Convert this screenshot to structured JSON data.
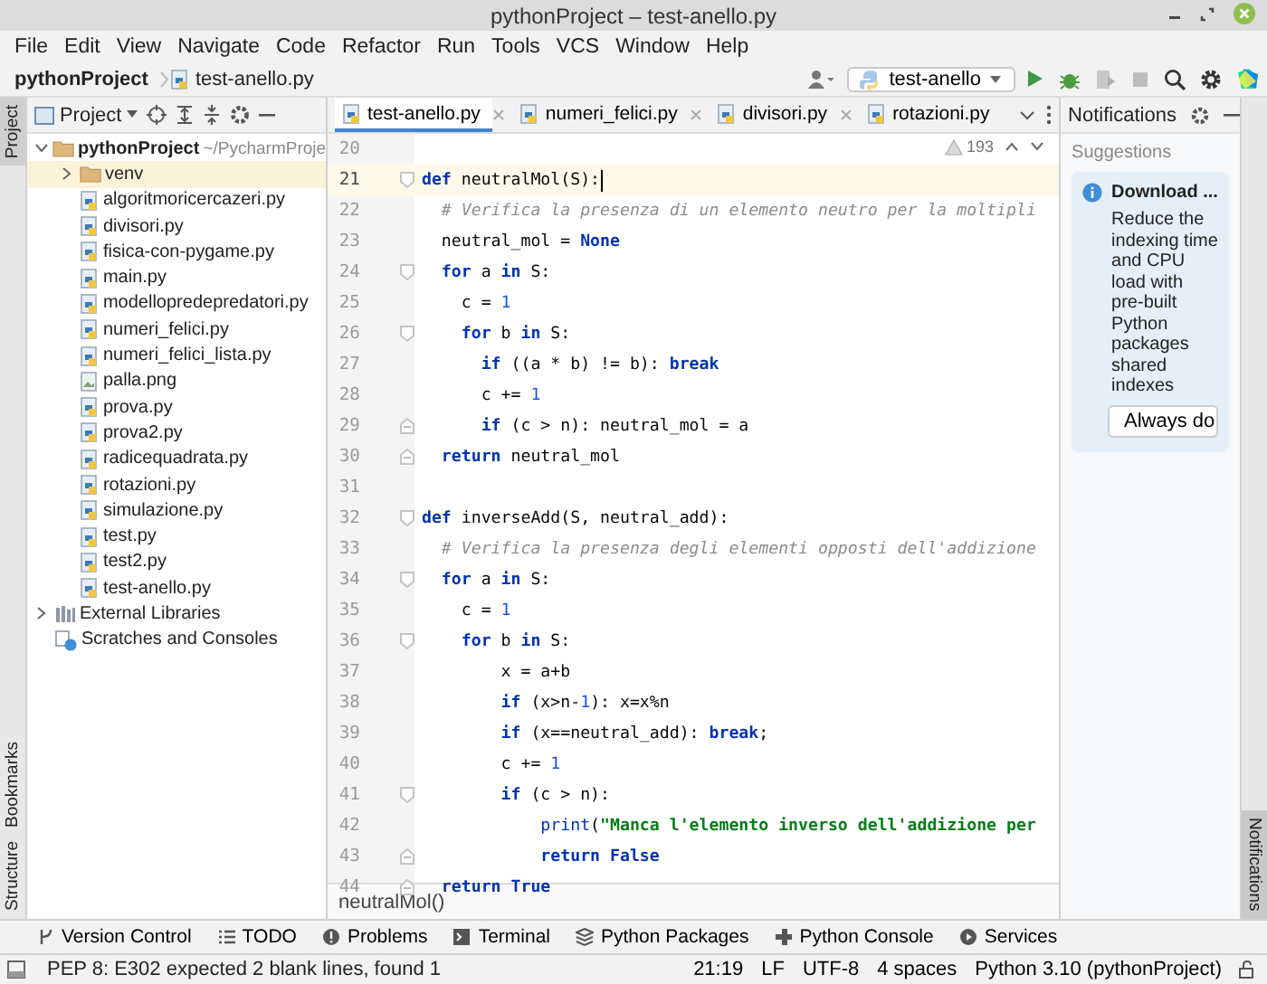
{
  "window": {
    "title": "pythonProject – test-anello.py"
  },
  "menu": [
    "File",
    "Edit",
    "View",
    "Navigate",
    "Code",
    "Refactor",
    "Run",
    "Tools",
    "VCS",
    "Window",
    "Help"
  ],
  "navbar": {
    "crumbs": [
      {
        "text": "pythonProject",
        "kind": "project"
      },
      {
        "text": "test-anello.py",
        "kind": "python"
      }
    ],
    "run_config": "test-anello"
  },
  "left_strip": [
    {
      "label": "Project",
      "selected": true
    },
    {
      "label": "Bookmarks",
      "selected": false
    },
    {
      "label": "Structure",
      "selected": false
    }
  ],
  "project_panel": {
    "title": "Project",
    "tree": [
      {
        "name": "pythonProject",
        "detail": "~/PycharmProje",
        "kind": "folder",
        "expanded": true,
        "children": [
          {
            "name": "venv",
            "kind": "folder",
            "expanded": false,
            "selected": true
          },
          {
            "name": "algoritmoricercazeri.py",
            "kind": "python"
          },
          {
            "name": "divisori.py",
            "kind": "python"
          },
          {
            "name": "fisica-con-pygame.py",
            "kind": "python"
          },
          {
            "name": "main.py",
            "kind": "python"
          },
          {
            "name": "modellopredepredatori.py",
            "kind": "python"
          },
          {
            "name": "numeri_felici.py",
            "kind": "python"
          },
          {
            "name": "numeri_felici_lista.py",
            "kind": "python"
          },
          {
            "name": "palla.png",
            "kind": "image"
          },
          {
            "name": "prova.py",
            "kind": "python"
          },
          {
            "name": "prova2.py",
            "kind": "python"
          },
          {
            "name": "radicequadrata.py",
            "kind": "python"
          },
          {
            "name": "rotazioni.py",
            "kind": "python"
          },
          {
            "name": "simulazione.py",
            "kind": "python"
          },
          {
            "name": "test.py",
            "kind": "python"
          },
          {
            "name": "test2.py",
            "kind": "python"
          },
          {
            "name": "test-anello.py",
            "kind": "python"
          }
        ]
      },
      {
        "name": "External Libraries",
        "kind": "library",
        "expanded": false
      },
      {
        "name": "Scratches and Consoles",
        "kind": "scratches"
      }
    ]
  },
  "editor": {
    "tabs": [
      {
        "label": "test-anello.py",
        "selected": true,
        "closable": true
      },
      {
        "label": "numeri_felici.py",
        "selected": false,
        "closable": true
      },
      {
        "label": "divisori.py",
        "selected": false,
        "closable": true
      },
      {
        "label": "rotazioni.py",
        "selected": false,
        "closable": false
      }
    ],
    "warnings": "193",
    "lines": [
      {
        "number": "20",
        "current": false
      },
      {
        "number": "21",
        "current": true,
        "fold_start": true,
        "tokens": [
          {
            "kind": "kw",
            "text": "def"
          },
          {
            "kind": "plain",
            "text": " neutralMol(S):"
          }
        ]
      },
      {
        "number": "22",
        "current": false,
        "tokens": [
          {
            "kind": "comment",
            "text": "  # Verifica la presenza di un elemento neutro per la moltipli"
          }
        ]
      },
      {
        "number": "23",
        "current": false,
        "tokens": [
          {
            "kind": "plain",
            "text": "  neutral_mol = "
          },
          {
            "kind": "kw",
            "text": "None"
          }
        ]
      },
      {
        "number": "24",
        "current": false,
        "fold_start": true,
        "tokens": [
          {
            "kind": "kw",
            "text": "  for"
          },
          {
            "kind": "plain",
            "text": " a "
          },
          {
            "kind": "kw",
            "text": "in"
          },
          {
            "kind": "plain",
            "text": " S:"
          }
        ]
      },
      {
        "number": "25",
        "current": false,
        "tokens": [
          {
            "kind": "plain",
            "text": "    c = "
          },
          {
            "kind": "num",
            "text": "1"
          }
        ]
      },
      {
        "number": "26",
        "current": false,
        "fold_start": true,
        "tokens": [
          {
            "kind": "kw",
            "text": "    for"
          },
          {
            "kind": "plain",
            "text": " b "
          },
          {
            "kind": "kw",
            "text": "in"
          },
          {
            "kind": "plain",
            "text": " S:"
          }
        ]
      },
      {
        "number": "27",
        "current": false,
        "tokens": [
          {
            "kind": "kw",
            "text": "      if"
          },
          {
            "kind": "plain",
            "text": " ((a * b) != b): "
          },
          {
            "kind": "kw",
            "text": "break"
          }
        ]
      },
      {
        "number": "28",
        "current": false,
        "tokens": [
          {
            "kind": "plain",
            "text": "      c += "
          },
          {
            "kind": "num",
            "text": "1"
          }
        ]
      },
      {
        "number": "29",
        "current": false,
        "fold_end": true,
        "tokens": [
          {
            "kind": "kw",
            "text": "      if"
          },
          {
            "kind": "plain",
            "text": " (c > n): neutral_mol = a"
          }
        ]
      },
      {
        "number": "30",
        "current": false,
        "fold_end": true,
        "tokens": [
          {
            "kind": "kw",
            "text": "  return"
          },
          {
            "kind": "plain",
            "text": " neutral_mol"
          }
        ]
      },
      {
        "number": "31",
        "current": false
      },
      {
        "number": "32",
        "current": false,
        "fold_start": true,
        "tokens": [
          {
            "kind": "kw",
            "text": "def"
          },
          {
            "kind": "plain",
            "text": " inverseAdd(S, neutral_add):"
          }
        ]
      },
      {
        "number": "33",
        "current": false,
        "tokens": [
          {
            "kind": "comment",
            "text": "  # Verifica la presenza degli elementi opposti dell'addizione"
          }
        ]
      },
      {
        "number": "34",
        "current": false,
        "fold_start": true,
        "tokens": [
          {
            "kind": "kw",
            "text": "  for"
          },
          {
            "kind": "plain",
            "text": " a "
          },
          {
            "kind": "kw",
            "text": "in"
          },
          {
            "kind": "plain",
            "text": " S:"
          }
        ]
      },
      {
        "number": "35",
        "current": false,
        "tokens": [
          {
            "kind": "plain",
            "text": "    c = "
          },
          {
            "kind": "num",
            "text": "1"
          }
        ]
      },
      {
        "number": "36",
        "current": false,
        "fold_start": true,
        "tokens": [
          {
            "kind": "kw",
            "text": "    for"
          },
          {
            "kind": "plain",
            "text": " b "
          },
          {
            "kind": "kw",
            "text": "in"
          },
          {
            "kind": "plain",
            "text": " S:"
          }
        ]
      },
      {
        "number": "37",
        "current": false,
        "tokens": [
          {
            "kind": "plain",
            "text": "        x = a+b"
          }
        ]
      },
      {
        "number": "38",
        "current": false,
        "tokens": [
          {
            "kind": "kw",
            "text": "        if"
          },
          {
            "kind": "plain",
            "text": " (x>n-"
          },
          {
            "kind": "num",
            "text": "1"
          },
          {
            "kind": "plain",
            "text": "): x=x%n"
          }
        ]
      },
      {
        "number": "39",
        "current": false,
        "tokens": [
          {
            "kind": "kw",
            "text": "        if"
          },
          {
            "kind": "plain",
            "text": " (x==neutral_add): "
          },
          {
            "kind": "kw",
            "text": "break"
          },
          {
            "kind": "plain",
            "text": ";"
          }
        ]
      },
      {
        "number": "40",
        "current": false,
        "tokens": [
          {
            "kind": "plain",
            "text": "        c += "
          },
          {
            "kind": "num",
            "text": "1"
          }
        ]
      },
      {
        "number": "41",
        "current": false,
        "fold_start": true,
        "tokens": [
          {
            "kind": "kw",
            "text": "        if"
          },
          {
            "kind": "plain",
            "text": " (c > n):"
          }
        ]
      },
      {
        "number": "42",
        "current": false,
        "tokens": [
          {
            "kind": "builtin",
            "text": "            print"
          },
          {
            "kind": "plain",
            "text": "("
          },
          {
            "kind": "str",
            "text": "\"Manca l'elemento inverso dell'addizione per"
          }
        ]
      },
      {
        "number": "43",
        "current": false,
        "fold_end": true,
        "tokens": [
          {
            "kind": "kw",
            "text": "            return"
          },
          {
            "kind": "kw",
            "text": " False"
          }
        ]
      },
      {
        "number": "44",
        "current": false,
        "fold_end": true,
        "tokens": [
          {
            "kind": "kw",
            "text": "  return"
          },
          {
            "kind": "kw",
            "text": " True"
          }
        ]
      }
    ],
    "breadcrumb": "neutralMol()"
  },
  "notifications": {
    "title": "Notifications",
    "section": "Suggestions",
    "card": {
      "title": "Download ...",
      "body": "Reduce the indexing time and CPU load with pre-built Python packages shared indexes",
      "button": "Always do"
    }
  },
  "right_strip": [
    {
      "label": "Notifications",
      "selected": true
    }
  ],
  "tool_windows": [
    {
      "label": "Version Control",
      "kind": "vcs"
    },
    {
      "label": "TODO",
      "kind": "list"
    },
    {
      "label": "Problems",
      "kind": "problems"
    },
    {
      "label": "Terminal",
      "kind": "terminal"
    },
    {
      "label": "Python Packages",
      "kind": "packages"
    },
    {
      "label": "Python Console",
      "kind": "console"
    },
    {
      "label": "Services",
      "kind": "services"
    }
  ],
  "status_bar": {
    "message": "PEP 8: E302 expected 2 blank lines, found 1",
    "items": [
      "21:19",
      "LF",
      "UTF-8",
      "4 spaces",
      "Python 3.10 (pythonProject)"
    ]
  }
}
